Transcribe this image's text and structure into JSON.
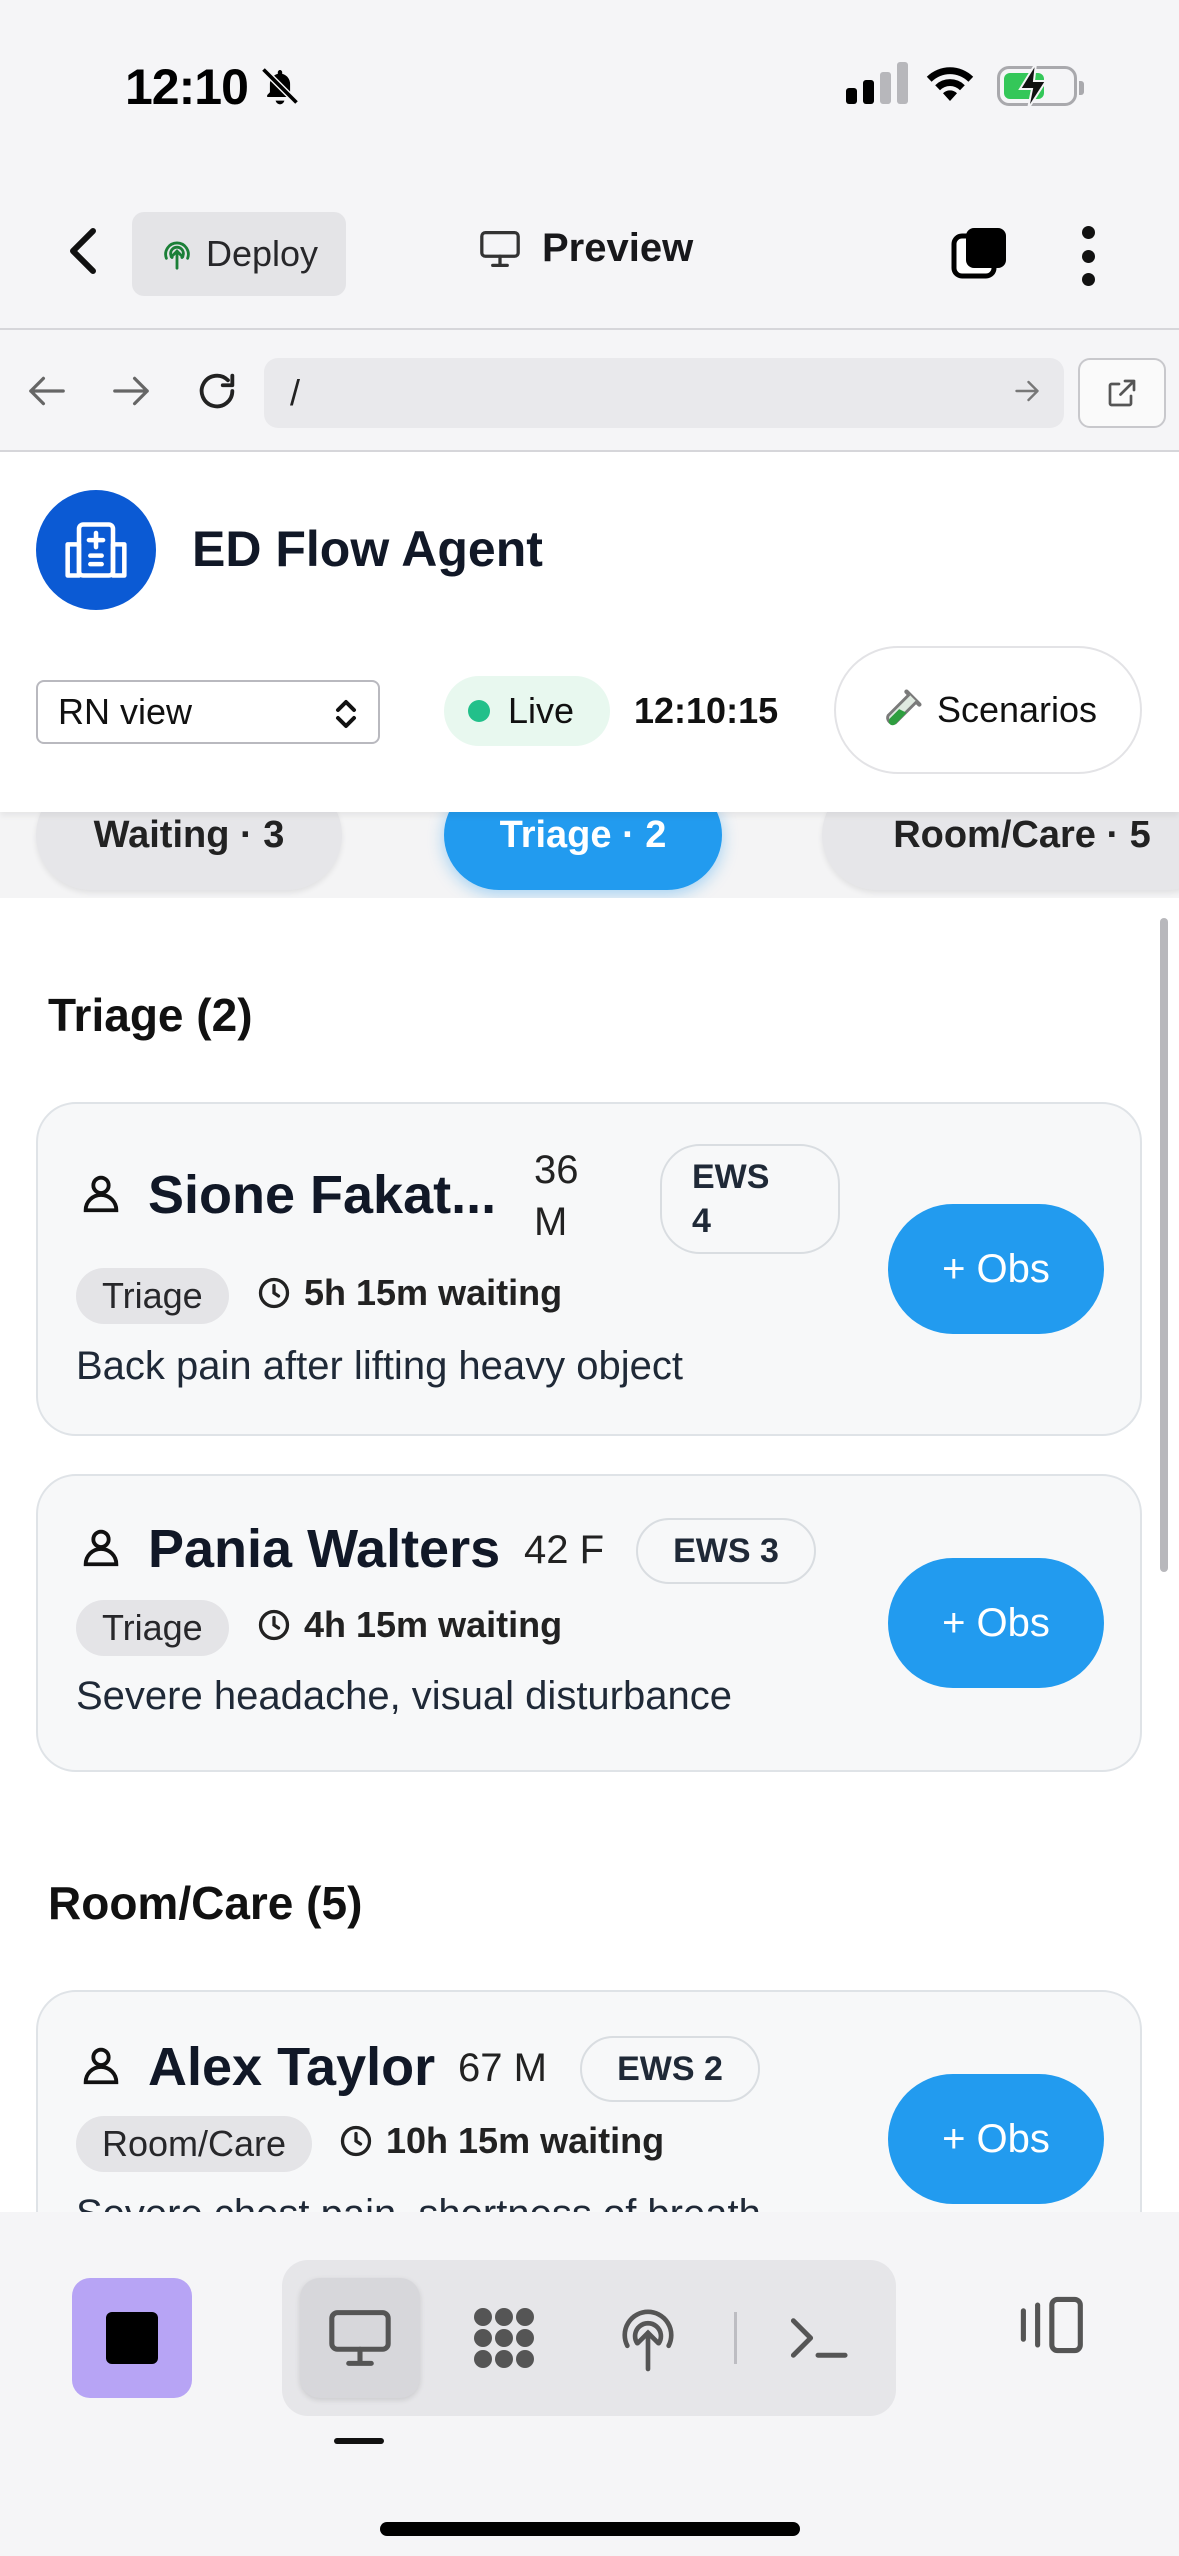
{
  "status_bar": {
    "time": "12:10"
  },
  "app_bar": {
    "deploy_label": "Deploy",
    "preview_label": "Preview"
  },
  "browser": {
    "url": "/"
  },
  "app": {
    "title": "ED Flow Agent",
    "view_select": "RN view",
    "live_label": "Live",
    "clock": "12:10:15",
    "scenarios_label": "Scenarios"
  },
  "filter_chips": [
    {
      "label": "Waiting · 3"
    },
    {
      "label": "Triage · 2"
    },
    {
      "label": "Room/Care · 5"
    }
  ],
  "sections": {
    "triage": {
      "title": "Triage (2)",
      "patients": [
        {
          "name": "Sione Fakat...",
          "age": "36",
          "sex": "M",
          "ews_label": "EWS",
          "ews_value": "4",
          "status": "Triage",
          "wait": "5h 15m waiting",
          "complaint": "Back pain after lifting heavy object",
          "obs_label": "+ Obs"
        },
        {
          "name": "Pania Walters",
          "age_sex": "42 F",
          "ews": "EWS 3",
          "status": "Triage",
          "wait": "4h 15m waiting",
          "complaint": "Severe headache, visual disturbance",
          "obs_label": "+ Obs"
        }
      ]
    },
    "room_care": {
      "title": "Room/Care (5)",
      "patients": [
        {
          "name": "Alex Taylor",
          "age_sex": "67 M",
          "ews": "EWS 2",
          "status": "Room/Care",
          "wait": "10h 15m waiting",
          "complaint": "Severe chest pain, shortness of breath",
          "obs_label": "+ Obs"
        }
      ]
    }
  },
  "toolbar": {
    "icons": [
      "stop-icon",
      "desktop-icon",
      "apps-icon",
      "deploy-icon",
      "terminal-icon",
      "panel-icon"
    ]
  },
  "colors": {
    "accent": "#229bef",
    "logo": "#0b5ad4",
    "live": "#22c08a",
    "stop": "#b7a4f5"
  }
}
